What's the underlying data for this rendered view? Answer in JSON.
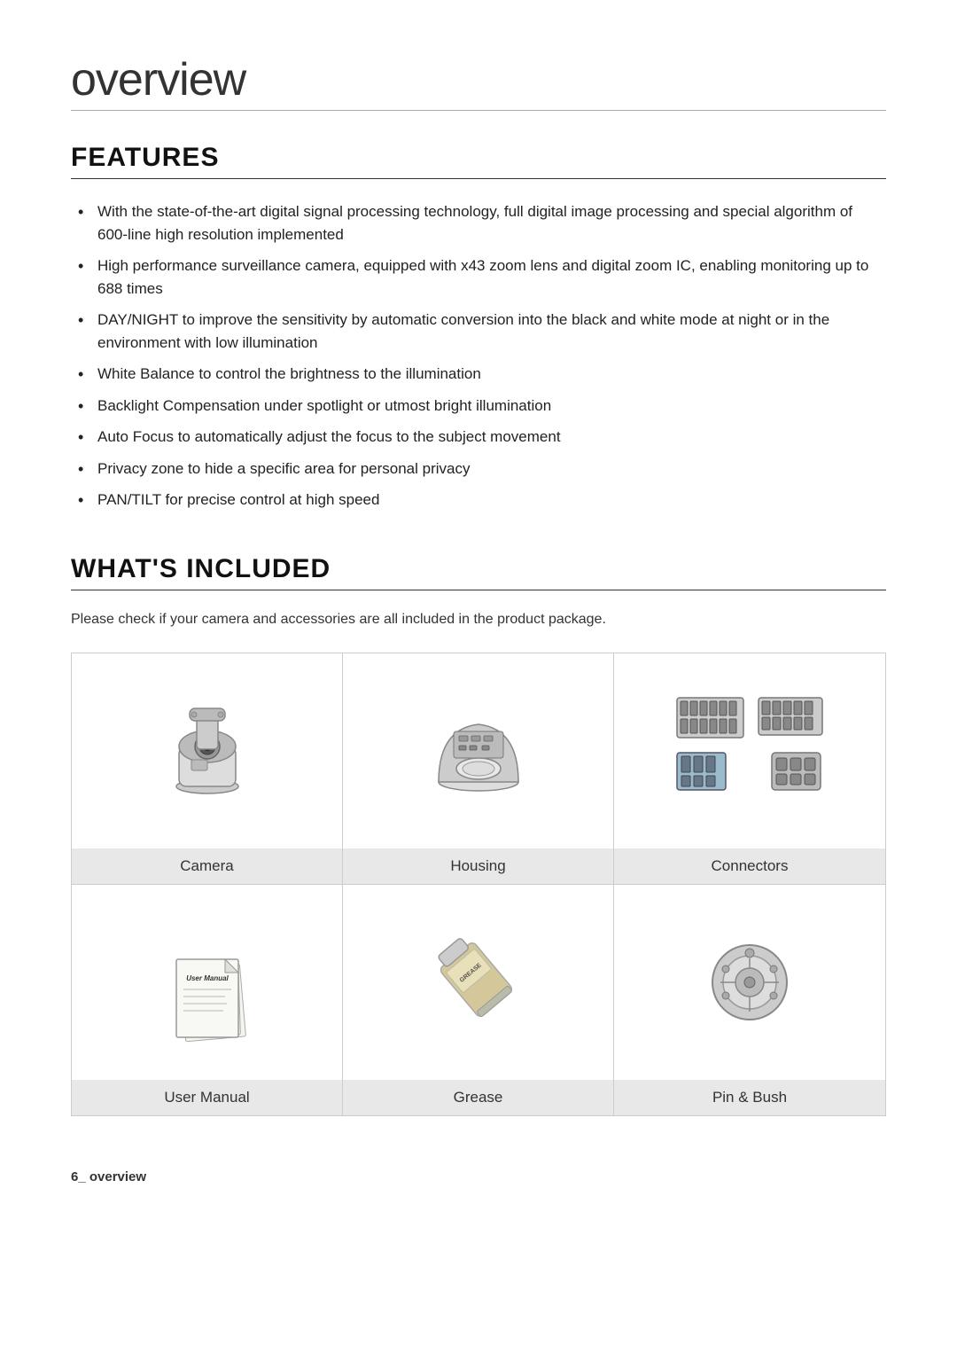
{
  "page": {
    "overview_title": "overview",
    "footer_text": "6_ overview"
  },
  "features": {
    "section_title": "FEATURES",
    "items": [
      "With the state-of-the-art digital signal processing technology, full digital image processing and special algorithm of 600-line high resolution implemented",
      "High performance surveillance camera, equipped with x43 zoom lens and digital zoom IC, enabling monitoring up to 688 times",
      "DAY/NIGHT to improve the sensitivity by automatic conversion into the black and white mode at night or in the environment with low illumination",
      "White Balance to control the brightness to the illumination",
      "Backlight Compensation under spotlight or utmost bright illumination",
      "Auto Focus to automatically adjust the focus to the subject movement",
      "Privacy zone to hide a specific area for personal privacy",
      "PAN/TILT for precise control at high speed"
    ]
  },
  "whats_included": {
    "section_title": "WHAT'S INCLUDED",
    "description": "Please check if your camera and accessories are all included in the product package.",
    "items": [
      {
        "id": "camera",
        "label": "Camera"
      },
      {
        "id": "housing",
        "label": "Housing"
      },
      {
        "id": "connectors",
        "label": "Connectors"
      },
      {
        "id": "user-manual",
        "label": "User Manual"
      },
      {
        "id": "grease",
        "label": "Grease"
      },
      {
        "id": "pin-bush",
        "label": "Pin & Bush"
      }
    ]
  }
}
